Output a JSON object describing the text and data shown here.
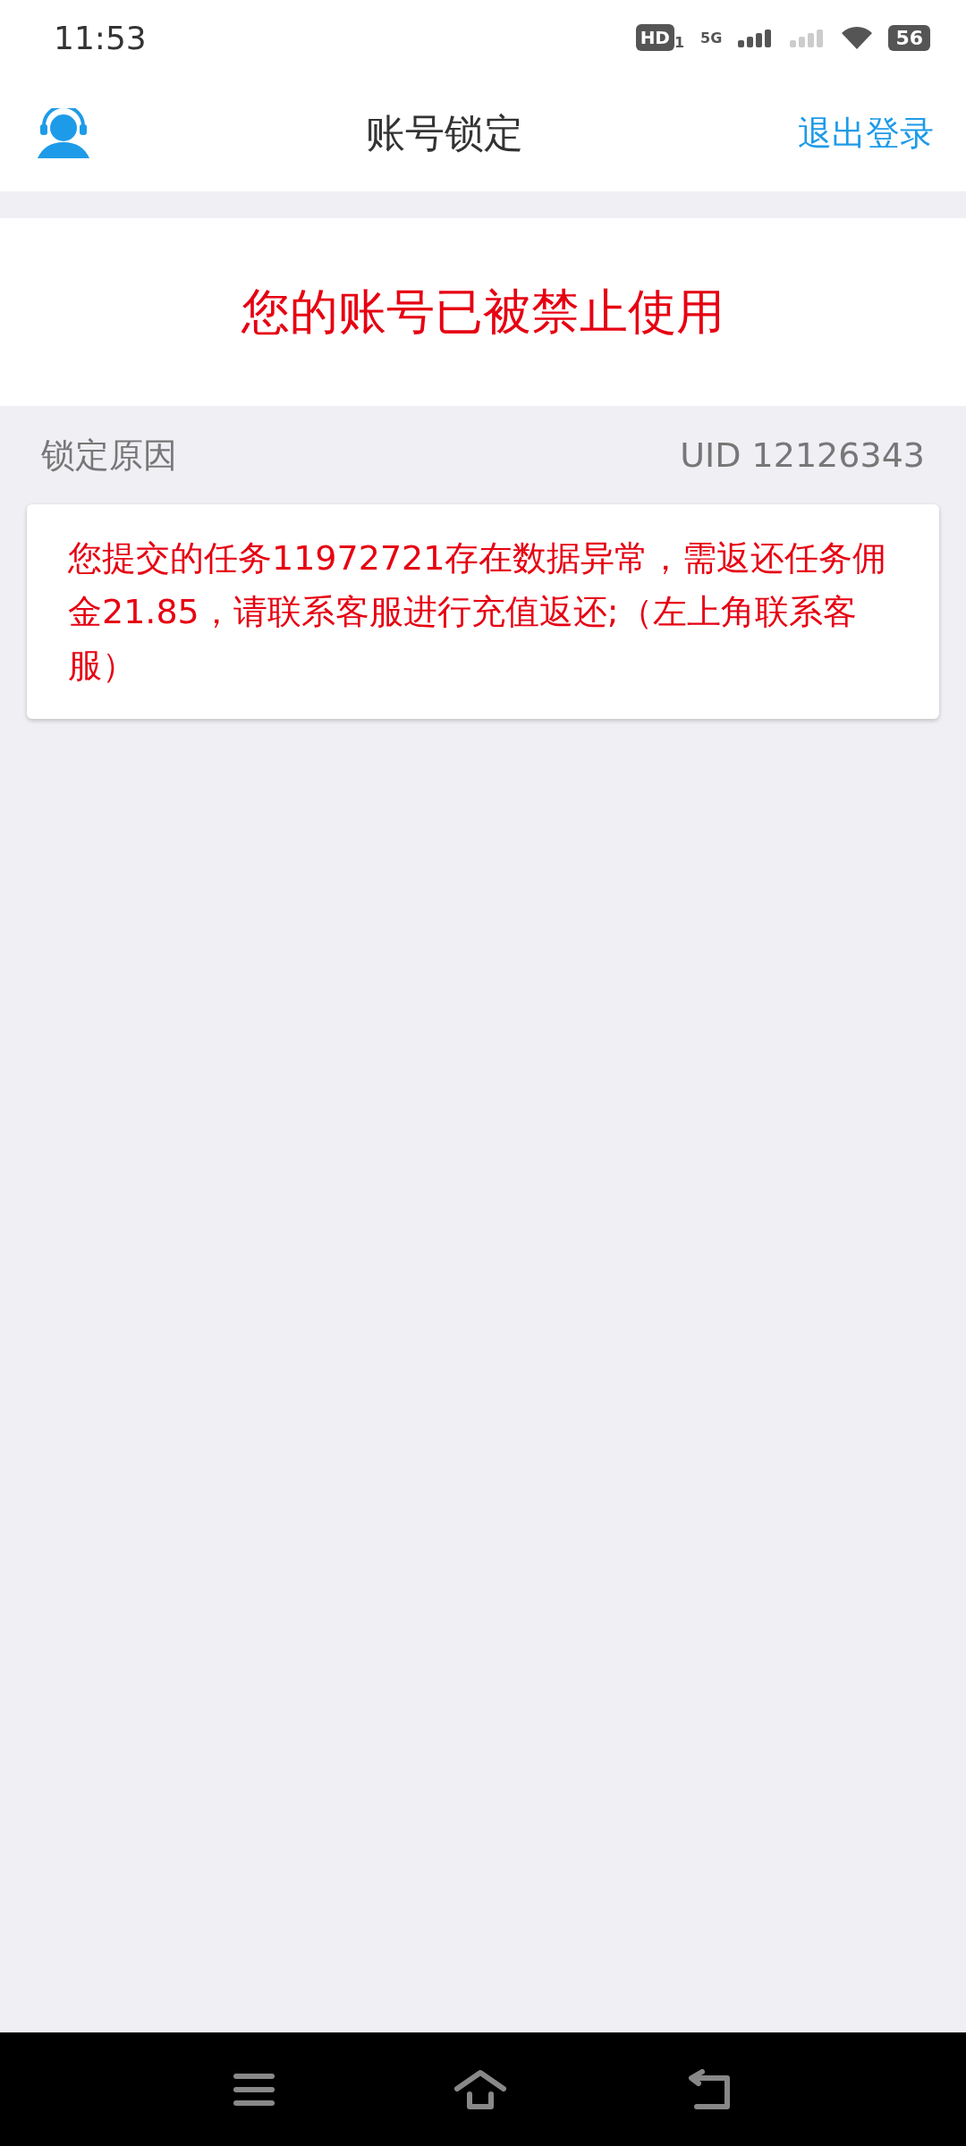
{
  "status_bar": {
    "time": "11:53",
    "hd": "HD",
    "hd_sub": "1",
    "network": "5G",
    "battery": "56"
  },
  "header": {
    "title": "账号锁定",
    "action": "退出登录"
  },
  "banner": {
    "message": "您的账号已被禁止使用"
  },
  "reason": {
    "label": "锁定原因",
    "uid": "UID 12126343",
    "text": "您提交的任务11972721存在数据异常，需返还任务佣金21.85，请联系客服进行充值返还;（左上角联系客服）"
  }
}
